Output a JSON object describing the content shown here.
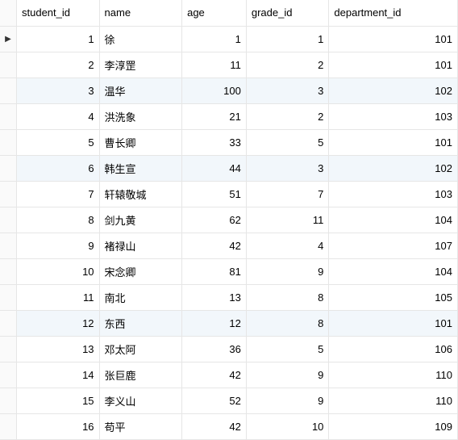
{
  "table": {
    "columns": [
      {
        "key": "student_id",
        "label": "student_id"
      },
      {
        "key": "name",
        "label": "name"
      },
      {
        "key": "age",
        "label": "age"
      },
      {
        "key": "grade_id",
        "label": "grade_id"
      },
      {
        "key": "department_id",
        "label": "department_id"
      }
    ],
    "rows": [
      {
        "student_id": "1",
        "name": "徐",
        "age": "1",
        "grade_id": "1",
        "department_id": "101"
      },
      {
        "student_id": "2",
        "name": "李淳罡",
        "age": "11",
        "grade_id": "2",
        "department_id": "101"
      },
      {
        "student_id": "3",
        "name": "温华",
        "age": "100",
        "grade_id": "3",
        "department_id": "102"
      },
      {
        "student_id": "4",
        "name": "洪洗象",
        "age": "21",
        "grade_id": "2",
        "department_id": "103"
      },
      {
        "student_id": "5",
        "name": "曹长卿",
        "age": "33",
        "grade_id": "5",
        "department_id": "101"
      },
      {
        "student_id": "6",
        "name": "韩生宣",
        "age": "44",
        "grade_id": "3",
        "department_id": "102"
      },
      {
        "student_id": "7",
        "name": "轩辕敬城",
        "age": "51",
        "grade_id": "7",
        "department_id": "103"
      },
      {
        "student_id": "8",
        "name": "剑九黄",
        "age": "62",
        "grade_id": "11",
        "department_id": "104"
      },
      {
        "student_id": "9",
        "name": "褚禄山",
        "age": "42",
        "grade_id": "4",
        "department_id": "107"
      },
      {
        "student_id": "10",
        "name": "宋念卿",
        "age": "81",
        "grade_id": "9",
        "department_id": "104"
      },
      {
        "student_id": "11",
        "name": "南北",
        "age": "13",
        "grade_id": "8",
        "department_id": "105"
      },
      {
        "student_id": "12",
        "name": "东西",
        "age": "12",
        "grade_id": "8",
        "department_id": "101"
      },
      {
        "student_id": "13",
        "name": "邓太阿",
        "age": "36",
        "grade_id": "5",
        "department_id": "106"
      },
      {
        "student_id": "14",
        "name": "张巨鹿",
        "age": "42",
        "grade_id": "9",
        "department_id": "110"
      },
      {
        "student_id": "15",
        "name": "李义山",
        "age": "52",
        "grade_id": "9",
        "department_id": "110"
      },
      {
        "student_id": "16",
        "name": "苟平",
        "age": "42",
        "grade_id": "10",
        "department_id": "109"
      }
    ],
    "current_row_marker": "▶",
    "current_row_index": 0
  }
}
